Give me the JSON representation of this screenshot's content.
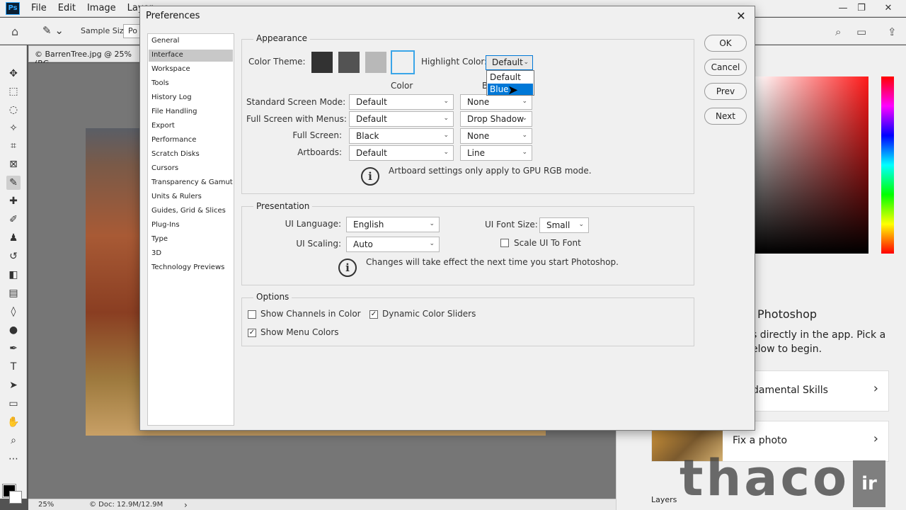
{
  "app": {
    "logo": "Ps",
    "menu": [
      "File",
      "Edit",
      "Image",
      "Layer"
    ],
    "options": {
      "sample_size_label": "Sample Size:",
      "sample_size_value": "Po"
    },
    "doc_tab": "© BarrenTree.jpg @ 25% (RG",
    "status": {
      "zoom": "25%",
      "doc": "© Doc: 12.9M/12.9M",
      "arrow": "›"
    },
    "learn": {
      "title": "Photoshop",
      "text": "s directly in the app. Pick a elow to begin.",
      "cards": [
        {
          "label": "damental Skills",
          "arrow": "›"
        },
        {
          "label": "Fix a photo",
          "arrow": "›"
        }
      ]
    },
    "layers_tab": "Layers",
    "watermark": "thaco",
    "watermark_badge": "ir"
  },
  "dialog": {
    "title": "Preferences",
    "close": "✕",
    "categories": [
      "General",
      "Interface",
      "Workspace",
      "Tools",
      "History Log",
      "File Handling",
      "Export",
      "Performance",
      "Scratch Disks",
      "Cursors",
      "Transparency & Gamut",
      "Units & Rulers",
      "Guides, Grid & Slices",
      "Plug-Ins",
      "Type",
      "3D",
      "Technology Previews"
    ],
    "selected_category": "Interface",
    "appearance": {
      "group_label": "Appearance",
      "color_theme_label": "Color Theme:",
      "theme_colors": [
        "#323232",
        "#535353",
        "#b8b8b8",
        "#f0f0f0"
      ],
      "highlight_label": "Highlight Color:",
      "highlight_value": "Default",
      "highlight_options": [
        "Default",
        "Blue"
      ],
      "highlight_hovered": "Blue",
      "col_color": "Color",
      "col_border_partial": "B",
      "rows": [
        {
          "label": "Standard Screen Mode:",
          "color": "Default",
          "border": "None"
        },
        {
          "label": "Full Screen with Menus:",
          "color": "Default",
          "border": "Drop Shadow"
        },
        {
          "label": "Full Screen:",
          "color": "Black",
          "border": "None"
        },
        {
          "label": "Artboards:",
          "color": "Default",
          "border": "Line"
        }
      ],
      "note": "Artboard settings only apply to GPU RGB mode."
    },
    "presentation": {
      "group_label": "Presentation",
      "ui_language_label": "UI Language:",
      "ui_language": "English",
      "ui_font_size_label": "UI Font Size:",
      "ui_font_size": "Small",
      "ui_scaling_label": "UI Scaling:",
      "ui_scaling": "Auto",
      "scale_ui_label": "Scale UI To Font",
      "note": "Changes will take effect the next time you start Photoshop."
    },
    "options": {
      "group_label": "Options",
      "show_channels": "Show Channels in Color",
      "dynamic_sliders": "Dynamic Color Sliders",
      "show_menu_colors": "Show Menu Colors"
    },
    "buttons": {
      "ok": "OK",
      "cancel": "Cancel",
      "prev": "Prev",
      "next": "Next"
    },
    "accent": "#0078d7"
  }
}
